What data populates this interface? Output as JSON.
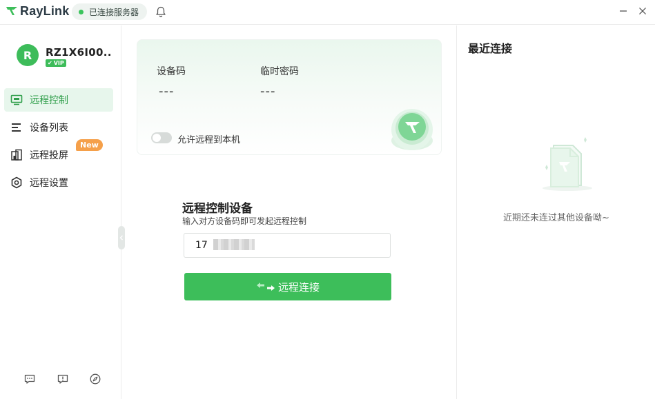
{
  "app": {
    "name": "RayLink",
    "status": "已连接服务器",
    "brand_color": "#3dbe5a"
  },
  "user": {
    "avatar_letter": "R",
    "name": "RZ1X6I00..",
    "badge": "VIP"
  },
  "sidebar": {
    "items": [
      {
        "label": "远程控制",
        "icon": "monitor-icon",
        "active": true
      },
      {
        "label": "设备列表",
        "icon": "list-icon",
        "active": false
      },
      {
        "label": "远程投屏",
        "icon": "screen-cast-icon",
        "active": false,
        "badge": "New"
      },
      {
        "label": "远程设置",
        "icon": "settings-hex-icon",
        "active": false
      }
    ],
    "footer_icons": [
      "feedback-icon",
      "report-icon",
      "compass-icon"
    ]
  },
  "device_card": {
    "device_code_label": "设备码",
    "device_code_value": "---",
    "temp_password_label": "临时密码",
    "temp_password_value": "---",
    "allow_remote_label": "允许远程到本机",
    "allow_remote_on": false
  },
  "remote_control": {
    "title": "远程控制设备",
    "subtitle": "输入对方设备码即可发起远程控制",
    "input_value": "17",
    "connect_label": "远程连接"
  },
  "recent": {
    "title": "最近连接",
    "empty_text": "近期还未连过其他设备呦~"
  }
}
